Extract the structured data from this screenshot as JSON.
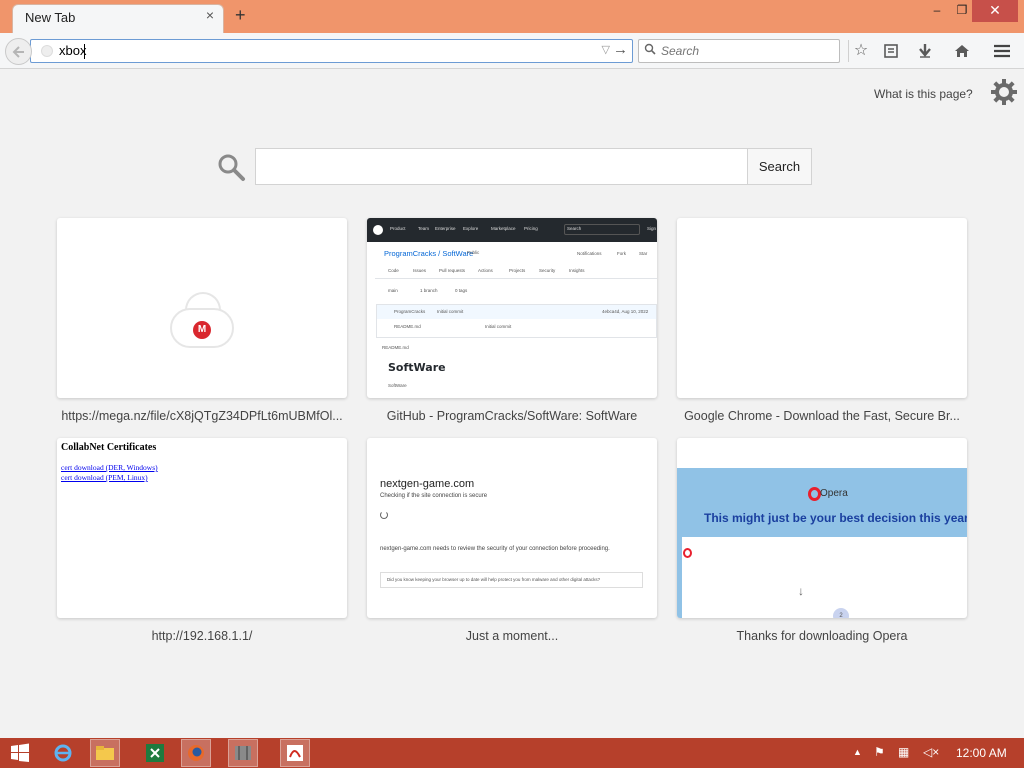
{
  "browser": {
    "tab_title": "New Tab",
    "tab_close_icon": "×",
    "new_tab_icon": "+",
    "window_controls": {
      "minimize": "–",
      "maximize": "❐",
      "close": "✕"
    },
    "url_value": "xbox",
    "search_placeholder": "Search",
    "toolbar_icons": [
      "bookmark-star-icon",
      "reading-list-icon",
      "download-icon",
      "home-icon",
      "menu-icon"
    ]
  },
  "newtab": {
    "what_is_this_page": "What is this page?",
    "search_button": "Search",
    "tiles": [
      {
        "label": "https://mega.nz/file/cX8jQTgZ34DPfLt6mUBMfOl...",
        "thumb": "mega"
      },
      {
        "label": "GitHub - ProgramCracks/SoftWare: SoftWare",
        "thumb": "github"
      },
      {
        "label": "Google Chrome - Download the Fast, Secure Br...",
        "thumb": "blank"
      },
      {
        "label": "http://192.168.1.1/",
        "thumb": "collabnet"
      },
      {
        "label": "Just a moment...",
        "thumb": "cloudflare"
      },
      {
        "label": "Thanks for downloading Opera",
        "thumb": "opera"
      }
    ]
  },
  "thumbs": {
    "mega_logo": "M",
    "github": {
      "nav": [
        "Product",
        "Team",
        "Enterprise",
        "Explore",
        "Marketplace",
        "Pricing"
      ],
      "search_hint": "Search",
      "sign": "Sign",
      "repo": "ProgramCracks / SoftWare",
      "public": "Public",
      "notifications": "Notifications",
      "fork": "Fork",
      "star": "Star",
      "tabs": [
        "Code",
        "Issues",
        "Pull requests",
        "Actions",
        "Projects",
        "Security",
        "Insights"
      ],
      "branch": "main",
      "branches": "1 branch",
      "tags": "0 tags",
      "commit_user": "ProgramCracks",
      "commit_msg": "Initial commit",
      "commit_date": "4ebca4d, Aug 10, 2022",
      "file": "README.md",
      "file_msg": "Initial commit",
      "readme_label": "README.md",
      "heading": "SoftWare",
      "sub": "SoftWare"
    },
    "collabnet": {
      "title": "CollabNet Certificates",
      "link1": "cert download (DER, Windows)",
      "link2": "cert download (PEM, Linux)"
    },
    "cloudflare": {
      "domain": "nextgen-game.com",
      "checking": "Checking if the site connection is secure",
      "desc": "nextgen-game.com needs to review the security of your connection before proceeding.",
      "box": "Did you know keeping your browser up to date will help protect you from malware and other digital attacks?"
    },
    "opera": {
      "logo_text": "Opera",
      "headline": "This might just be your best decision this year",
      "badge": "2"
    }
  },
  "taskbar": {
    "items": [
      "start-icon",
      "internet-explorer-icon",
      "file-explorer-icon",
      "excel-icon",
      "firefox-icon",
      "app-icon",
      "pdf-icon"
    ],
    "clock": "12:00 AM"
  }
}
